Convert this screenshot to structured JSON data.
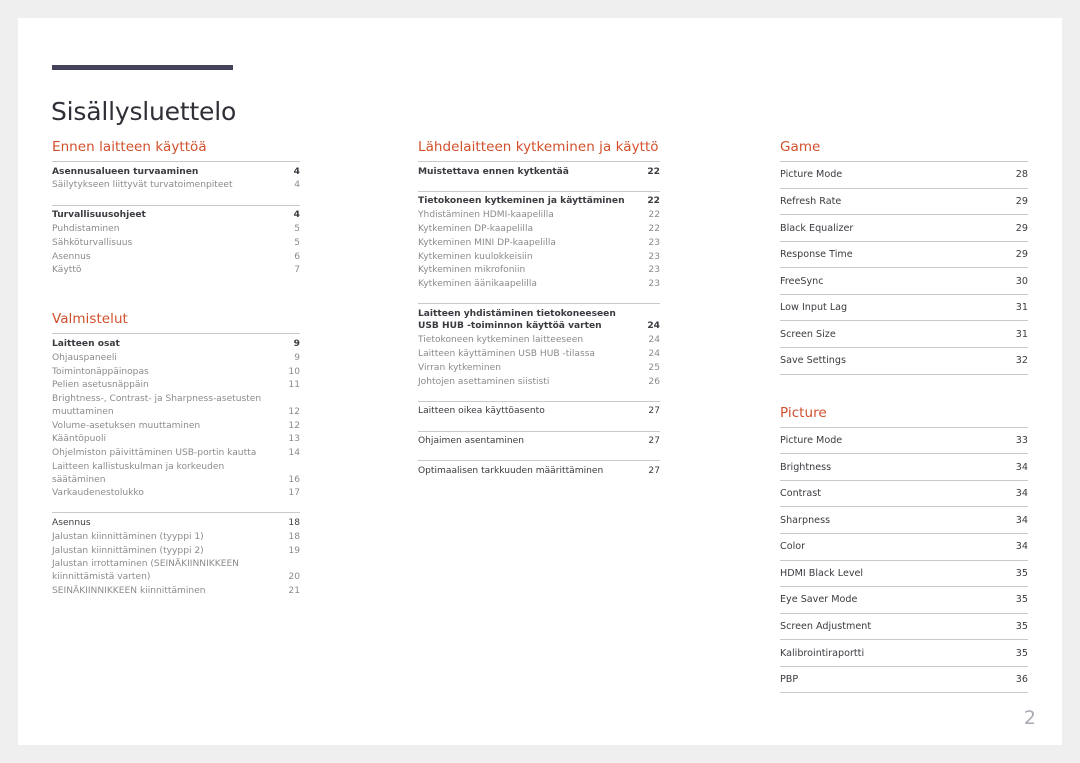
{
  "document": {
    "title": "Sisällysluettelo",
    "page_number": "2",
    "accent_color": "#d2502c",
    "rule_color": "#43425a"
  },
  "columns": [
    {
      "name": "column-1",
      "sections": [
        {
          "heading": "Ennen laitteen käyttöä",
          "groups": [
            {
              "rows": [
                {
                  "label": "Asennusalueen turvaaminen",
                  "page": "4",
                  "level": 1
                },
                {
                  "label": "Säilytykseen liittyvät turvatoimenpiteet",
                  "page": "4",
                  "level": 2
                }
              ]
            },
            {
              "rows": [
                {
                  "label": "Turvallisuusohjeet",
                  "page": "4",
                  "level": 1
                },
                {
                  "label": "Puhdistaminen",
                  "page": "5",
                  "level": 2
                },
                {
                  "label": "Sähköturvallisuus",
                  "page": "5",
                  "level": 2
                },
                {
                  "label": "Asennus",
                  "page": "6",
                  "level": 2
                },
                {
                  "label": "Käyttö",
                  "page": "7",
                  "level": 2
                }
              ]
            }
          ]
        },
        {
          "heading": "Valmistelut",
          "groups": [
            {
              "rows": [
                {
                  "label": "Laitteen osat",
                  "page": "9",
                  "level": 1
                },
                {
                  "label": "Ohjauspaneeli",
                  "page": "9",
                  "level": 2
                },
                {
                  "label": "Toimintonäppäinopas",
                  "page": "10",
                  "level": 2
                },
                {
                  "label": "Pelien asetusnäppäin",
                  "page": "11",
                  "level": 2
                },
                {
                  "label": "Brightness-, Contrast- ja Sharpness-asetusten muuttaminen",
                  "page": "12",
                  "level": 2
                },
                {
                  "label": "Volume-asetuksen muuttaminen",
                  "page": "12",
                  "level": 2
                },
                {
                  "label": "Kääntöpuoli",
                  "page": "13",
                  "level": 2
                },
                {
                  "label": "Ohjelmiston päivittäminen USB-portin kautta",
                  "page": "14",
                  "level": 2
                },
                {
                  "label": "Laitteen kallistuskulman ja korkeuden säätäminen",
                  "page": "16",
                  "level": 2
                },
                {
                  "label": "Varkaudenestolukko",
                  "page": "17",
                  "level": 2
                }
              ]
            },
            {
              "rows": [
                {
                  "label": "Asennus",
                  "page": "18",
                  "level": 3
                },
                {
                  "label": "Jalustan kiinnittäminen (tyyppi 1)",
                  "page": "18",
                  "level": 2
                },
                {
                  "label": "Jalustan kiinnittäminen (tyyppi 2)",
                  "page": "19",
                  "level": 2
                },
                {
                  "label": "Jalustan irrottaminen (SEINÄKIINNIKKEEN kiinnittämistä varten)",
                  "page": "20",
                  "level": 2
                },
                {
                  "label": "SEINÄKIINNIKKEEN kiinnittäminen",
                  "page": "21",
                  "level": 2
                }
              ]
            }
          ]
        }
      ]
    },
    {
      "name": "column-2",
      "sections": [
        {
          "heading": "Lähdelaitteen kytkeminen ja käyttö",
          "groups": [
            {
              "rows": [
                {
                  "label": "Muistettava ennen kytkentää",
                  "page": "22",
                  "level": 1
                }
              ]
            },
            {
              "rows": [
                {
                  "label": "Tietokoneen kytkeminen ja käyttäminen",
                  "page": "22",
                  "level": 1
                },
                {
                  "label": "Yhdistäminen HDMI-kaapelilla",
                  "page": "22",
                  "level": 2
                },
                {
                  "label": "Kytkeminen DP-kaapelilla",
                  "page": "22",
                  "level": 2
                },
                {
                  "label": "Kytkeminen MINI DP-kaapelilla",
                  "page": "23",
                  "level": 2
                },
                {
                  "label": "Kytkeminen kuulokkeisiin",
                  "page": "23",
                  "level": 2
                },
                {
                  "label": "Kytkeminen mikrofoniin",
                  "page": "23",
                  "level": 2
                },
                {
                  "label": "Kytkeminen äänikaapelilla",
                  "page": "23",
                  "level": 2
                }
              ]
            },
            {
              "rows": [
                {
                  "label": "Laitteen yhdistäminen tietokoneeseen USB HUB -toiminnon käyttöä varten",
                  "page": "24",
                  "level": 1
                },
                {
                  "label": "Tietokoneen kytkeminen laitteeseen",
                  "page": "24",
                  "level": 2
                },
                {
                  "label": "Laitteen käyttäminen USB HUB -tilassa",
                  "page": "24",
                  "level": 2
                },
                {
                  "label": "Virran kytkeminen",
                  "page": "25",
                  "level": 2
                },
                {
                  "label": "Johtojen asettaminen siististi",
                  "page": "26",
                  "level": 2
                }
              ]
            },
            {
              "rows": [
                {
                  "label": "Laitteen oikea käyttöasento",
                  "page": "27",
                  "level": 3
                }
              ]
            },
            {
              "rows": [
                {
                  "label": "Ohjaimen asentaminen",
                  "page": "27",
                  "level": 3
                }
              ]
            },
            {
              "rows": [
                {
                  "label": "Optimaalisen tarkkuuden määrittäminen",
                  "page": "27",
                  "level": 3
                }
              ]
            }
          ]
        }
      ]
    },
    {
      "name": "column-3",
      "sections": [
        {
          "heading": "Game",
          "rows": [
            {
              "label": "Picture Mode",
              "page": "28"
            },
            {
              "label": "Refresh Rate",
              "page": "29"
            },
            {
              "label": "Black Equalizer",
              "page": "29"
            },
            {
              "label": "Response Time",
              "page": "29"
            },
            {
              "label": "FreeSync",
              "page": "30"
            },
            {
              "label": "Low Input Lag",
              "page": "31"
            },
            {
              "label": "Screen Size",
              "page": "31"
            },
            {
              "label": "Save Settings",
              "page": "32"
            }
          ]
        },
        {
          "heading": "Picture",
          "rows": [
            {
              "label": "Picture Mode",
              "page": "33"
            },
            {
              "label": "Brightness",
              "page": "34"
            },
            {
              "label": "Contrast",
              "page": "34"
            },
            {
              "label": "Sharpness",
              "page": "34"
            },
            {
              "label": "Color",
              "page": "34"
            },
            {
              "label": "HDMI Black Level",
              "page": "35"
            },
            {
              "label": "Eye Saver Mode",
              "page": "35"
            },
            {
              "label": "Screen Adjustment",
              "page": "35"
            },
            {
              "label": "Kalibrointiraportti",
              "page": "35"
            },
            {
              "label": "PBP",
              "page": "36"
            }
          ]
        }
      ]
    }
  ]
}
